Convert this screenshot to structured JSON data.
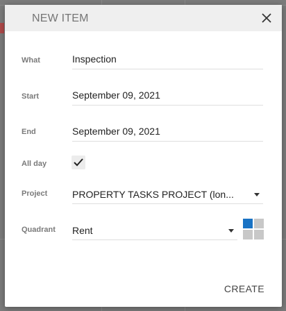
{
  "dialog": {
    "title": "NEW ITEM",
    "close_icon": "close-icon",
    "create_label": "CREATE"
  },
  "form": {
    "what": {
      "label": "What",
      "value": "Inspection"
    },
    "start": {
      "label": "Start",
      "value": "September 09, 2021"
    },
    "end": {
      "label": "End",
      "value": "September 09, 2021"
    },
    "all_day": {
      "label": "All day",
      "checked": true,
      "icon": "checkmark-icon"
    },
    "project": {
      "label": "Project",
      "value": "PROPERTY TASKS PROJECT (lon...",
      "icon": "dropdown-arrow-icon"
    },
    "quadrant": {
      "label": "Quadrant",
      "value": "Rent",
      "icon": "dropdown-arrow-icon",
      "picker_colors": [
        "#1a73c4",
        "#c8c8c8",
        "#c8c8c8",
        "#c8c8c8"
      ]
    }
  },
  "colors": {
    "header_bg": "#efefef",
    "accent": "#1a73c4",
    "overlay": "#7c7c7c"
  }
}
